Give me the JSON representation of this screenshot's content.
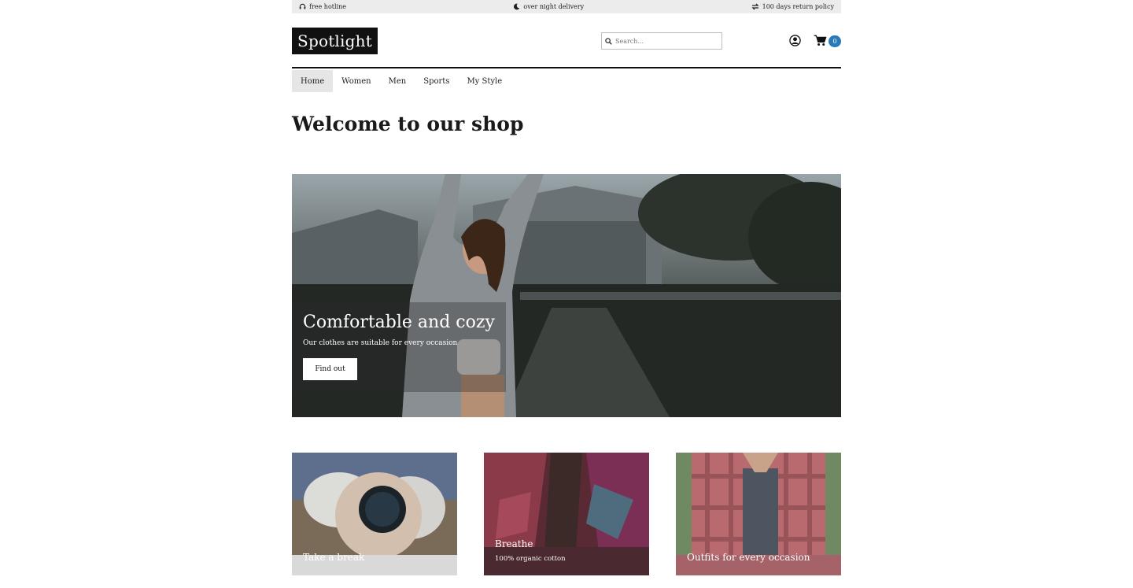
{
  "topbar": {
    "hotline": "free hotline",
    "delivery": "over night delivery",
    "returns": "100 days return policy"
  },
  "header": {
    "logo": "Spotlight",
    "search_placeholder": "Search...",
    "cart_count": "0"
  },
  "nav": {
    "items": [
      "Home",
      "Women",
      "Men",
      "Sports",
      "My Style"
    ],
    "active": "Home"
  },
  "page": {
    "title": "Welcome to our shop"
  },
  "hero": {
    "title": "Comfortable and cozy",
    "subtitle": "Our clothes are suitable for every occasion",
    "button": "Find out"
  },
  "cards": [
    {
      "title": "Take a break",
      "subtitle": ""
    },
    {
      "title": "Breathe",
      "subtitle": "100% organic cotton"
    },
    {
      "title": "Outfits for every occasion",
      "subtitle": ""
    }
  ],
  "colors": {
    "accent": "#2a79b8",
    "dark": "#111111",
    "topbar": "#ececec"
  }
}
